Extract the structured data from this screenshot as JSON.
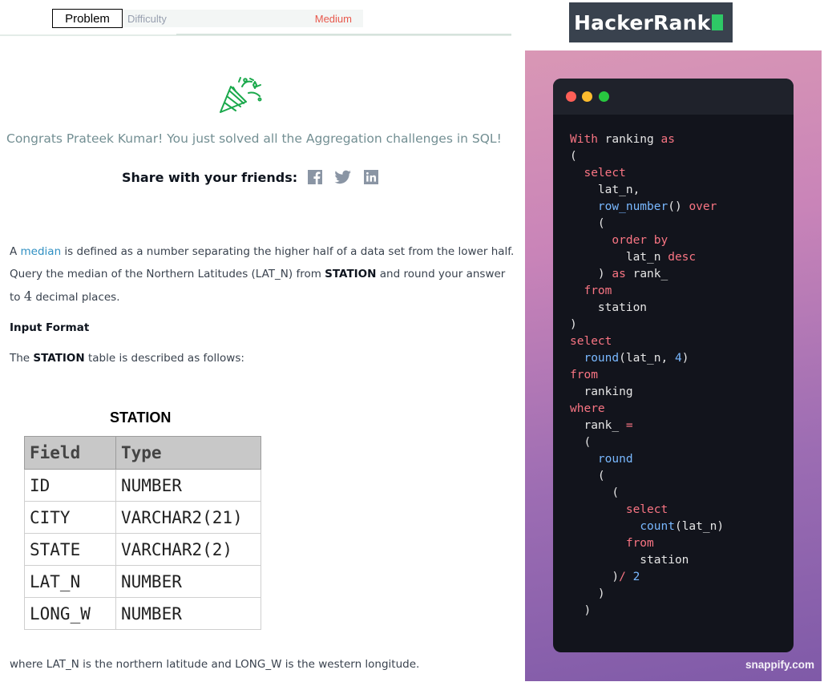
{
  "tabs": {
    "problem_label": "Problem",
    "difficulty_label": "Difficulty",
    "difficulty_value": "Medium"
  },
  "congrats": {
    "message": "Congrats Prateek Kumar! You just solved all the Aggregation challenges in SQL!",
    "share_label": "Share with your friends:",
    "share_icons": [
      "facebook-icon",
      "twitter-icon",
      "linkedin-icon"
    ]
  },
  "problem": {
    "p1_prefix": "A ",
    "p1_link": "median",
    "p1_suffix": " is defined as a number separating the higher half of a data set from the lower half.",
    "p2_prefix": "Query the median of the Northern Latitudes (LAT_N) from ",
    "p2_bold": "STATION",
    "p2_suffix": " and round your answer",
    "p3_prefix": "to ",
    "p3_num": "4",
    "p3_suffix": " decimal places.",
    "input_format_heading": "Input Format",
    "p4_prefix": "The ",
    "p4_bold": "STATION",
    "p4_suffix": " table is described as follows:",
    "footer_note": "where LAT_N is the northern latitude and LONG_W is the western longitude."
  },
  "station_table": {
    "title": "STATION",
    "headers": [
      "Field",
      "Type"
    ],
    "rows": [
      [
        "ID",
        "NUMBER"
      ],
      [
        "CITY",
        "VARCHAR2(21)"
      ],
      [
        "STATE",
        "VARCHAR2(2)"
      ],
      [
        "LAT_N",
        "NUMBER"
      ],
      [
        "LONG_W",
        "NUMBER"
      ]
    ]
  },
  "brand": {
    "logo_text": "HackerRank",
    "credit": "snappify.com"
  },
  "code_lines": [
    [
      [
        "kw",
        "With"
      ],
      [
        "t",
        " ranking "
      ],
      [
        "kw",
        "as"
      ]
    ],
    [
      [
        "t",
        "("
      ]
    ],
    [
      [
        "t",
        "  "
      ],
      [
        "kw",
        "select"
      ]
    ],
    [
      [
        "t",
        "    lat_n,"
      ]
    ],
    [
      [
        "t",
        "    "
      ],
      [
        "fn",
        "row_number"
      ],
      [
        "t",
        "() "
      ],
      [
        "kw",
        "over"
      ]
    ],
    [
      [
        "t",
        "    ("
      ]
    ],
    [
      [
        "t",
        "      "
      ],
      [
        "kw",
        "order by"
      ]
    ],
    [
      [
        "t",
        "        lat_n "
      ],
      [
        "kw",
        "desc"
      ]
    ],
    [
      [
        "t",
        "    ) "
      ],
      [
        "kw",
        "as"
      ],
      [
        "t",
        " rank_"
      ]
    ],
    [
      [
        "t",
        "  "
      ],
      [
        "kw",
        "from"
      ]
    ],
    [
      [
        "t",
        "    station"
      ]
    ],
    [
      [
        "t",
        ")"
      ]
    ],
    [
      [
        "kw",
        "select"
      ]
    ],
    [
      [
        "t",
        "  "
      ],
      [
        "fn",
        "round"
      ],
      [
        "t",
        "(lat_n, "
      ],
      [
        "num",
        "4"
      ],
      [
        "t",
        ")"
      ]
    ],
    [
      [
        "kw",
        "from"
      ]
    ],
    [
      [
        "t",
        "  ranking"
      ]
    ],
    [
      [
        "kw",
        "where"
      ]
    ],
    [
      [
        "t",
        "  rank_ "
      ],
      [
        "kw",
        "="
      ]
    ],
    [
      [
        "t",
        "  ("
      ]
    ],
    [
      [
        "t",
        "    "
      ],
      [
        "fn",
        "round"
      ]
    ],
    [
      [
        "t",
        "    ("
      ]
    ],
    [
      [
        "t",
        "      ("
      ]
    ],
    [
      [
        "t",
        "        "
      ],
      [
        "kw",
        "select"
      ]
    ],
    [
      [
        "t",
        "          "
      ],
      [
        "fn",
        "count"
      ],
      [
        "t",
        "(lat_n)"
      ]
    ],
    [
      [
        "t",
        "        "
      ],
      [
        "kw",
        "from"
      ]
    ],
    [
      [
        "t",
        "          station"
      ]
    ],
    [
      [
        "t",
        "      )"
      ],
      [
        "kw",
        "/"
      ],
      [
        "t",
        " "
      ],
      [
        "num",
        "2"
      ]
    ],
    [
      [
        "t",
        "    )"
      ]
    ],
    [
      [
        "t",
        "  )"
      ]
    ]
  ]
}
